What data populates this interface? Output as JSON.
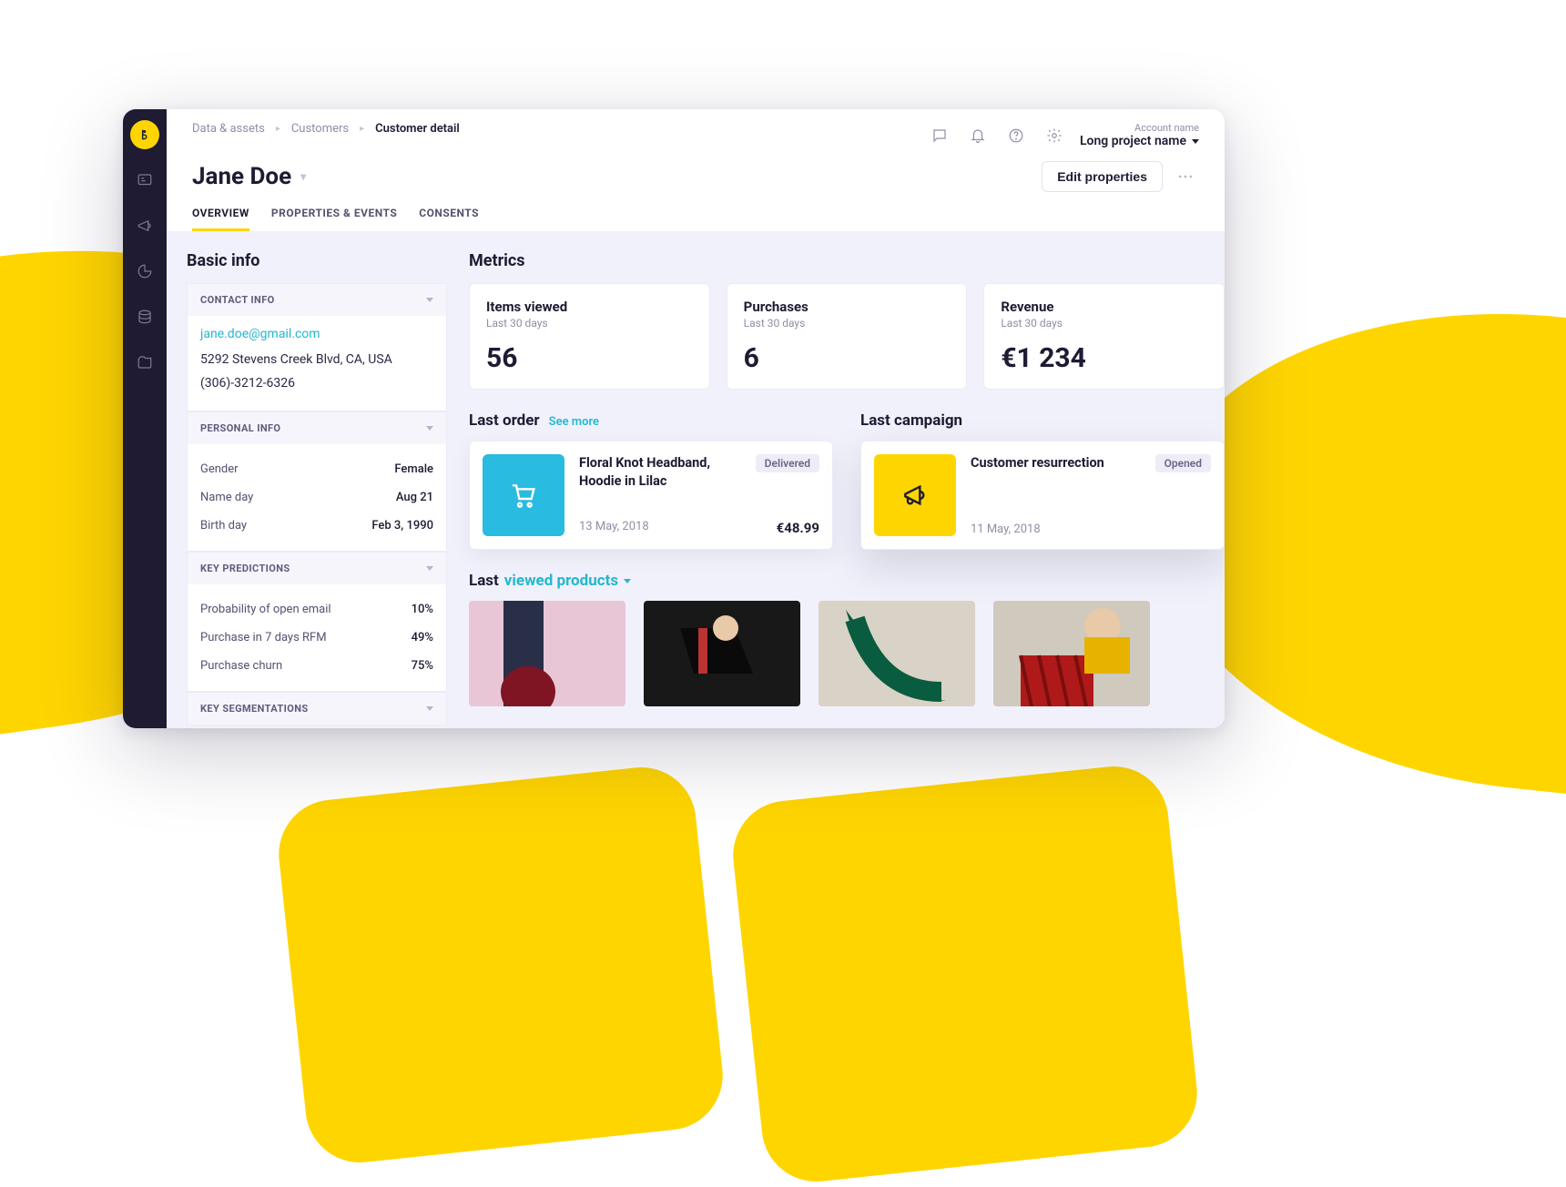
{
  "breadcrumb": [
    "Data & assets",
    "Customers",
    "Customer detail"
  ],
  "account": {
    "label": "Account name",
    "project": "Long project name"
  },
  "customer_name": "Jane Doe",
  "edit_label": "Edit properties",
  "tabs": [
    "OVERVIEW",
    "PROPERTIES & EVENTS",
    "CONSENTS"
  ],
  "basic_info_title": "Basic info",
  "contact": {
    "header": "CONTACT INFO",
    "email": "jane.doe@gmail.com",
    "address": "5292 Stevens Creek Blvd, CA, USA",
    "phone": "(306)-3212-6326"
  },
  "personal": {
    "header": "PERSONAL INFO",
    "rows": [
      {
        "k": "Gender",
        "v": "Female"
      },
      {
        "k": "Name day",
        "v": "Aug 21"
      },
      {
        "k": "Birth day",
        "v": "Feb 3, 1990"
      }
    ]
  },
  "predictions": {
    "header": "KEY PREDICTIONS",
    "rows": [
      {
        "k": "Probability of open email",
        "v": "10%"
      },
      {
        "k": "Purchase in 7 days RFM",
        "v": "49%"
      },
      {
        "k": "Purchase churn",
        "v": "75%"
      }
    ]
  },
  "segmentations": {
    "header": "KEY SEGMENTATIONS"
  },
  "metrics_title": "Metrics",
  "metrics": [
    {
      "title": "Items viewed",
      "sub": "Last 30 days",
      "value": "56"
    },
    {
      "title": "Purchases",
      "sub": "Last 30 days",
      "value": "6"
    },
    {
      "title": "Revenue",
      "sub": "Last 30 days",
      "value": "€1 234"
    }
  ],
  "last_order": {
    "heading": "Last order",
    "see_more": "See more",
    "title": "Floral Knot Headband, Hoodie in Lilac",
    "badge": "Delivered",
    "date": "13 May, 2018",
    "price": "€48.99"
  },
  "last_campaign": {
    "heading": "Last campaign",
    "title": "Customer resurrection",
    "badge": "Opened",
    "date": "11 May, 2018"
  },
  "viewed_products": {
    "label_prefix": "Last",
    "label_drop": "viewed products"
  }
}
